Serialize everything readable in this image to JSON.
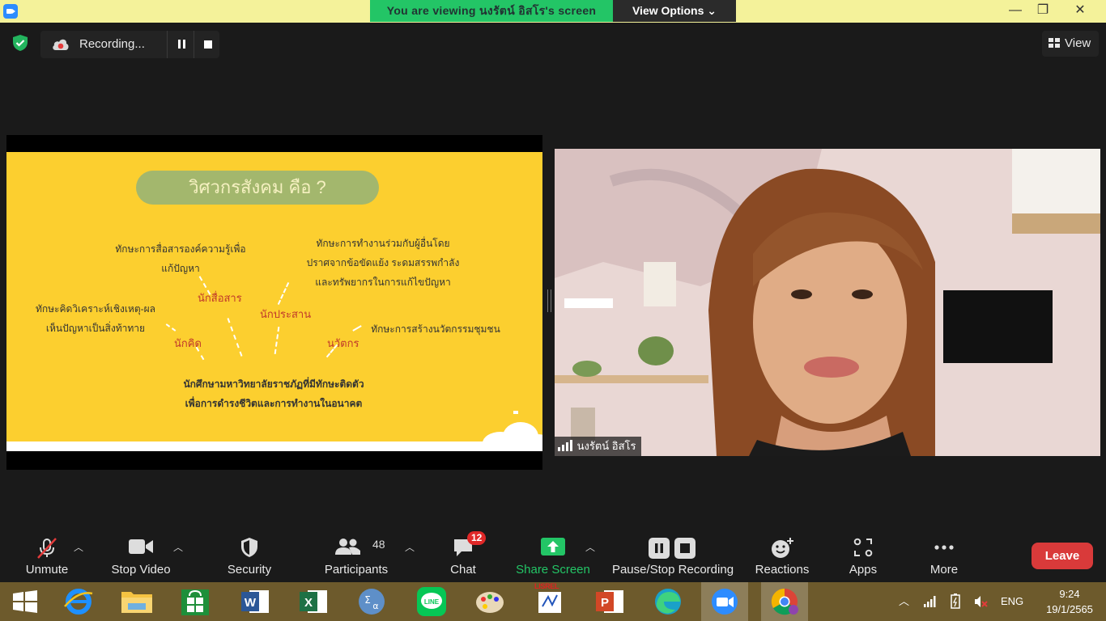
{
  "top_bar": {
    "viewing_banner": "You are viewing นงรัตน์ อิสโร's screen",
    "view_options_label": "View Options",
    "minimize_glyph": "—",
    "restore_glyph": "❐",
    "close_glyph": "✕"
  },
  "meeting_bar": {
    "recording_label": "Recording...",
    "view_label": "View"
  },
  "slide": {
    "title": "วิศวกรสังคม คือ ?",
    "text_communication_1": "ทักษะการสื่อสารองค์ความรู้เพื่อ",
    "text_communication_2": "แก้ปัญหา",
    "label_communicator": "นักสื่อสาร",
    "text_collab_1": "ทักษะการทำงานร่วมกับผู้อื่นโดย",
    "text_collab_2": "ปราศจากข้อขัดแย้ง ระดมสรรพกำลัง",
    "text_collab_3": "และทรัพยากรในการแก้ไขปัญหา",
    "label_coordinator": "นักประสาน",
    "text_thinking_1": "ทักษะคิดวิเคราะห์เชิงเหตุ-ผล",
    "text_thinking_2": "เห็นปัญหาเป็นสิ่งท้าทาย",
    "label_thinker": "นักคิด",
    "text_innovation": "ทักษะการสร้างนวัตกรรมชุมชน",
    "label_innovator": "นวัตกร",
    "text_bottom_1": "นักศึกษามหาวิทยาลัยราชภัฏที่มีทักษะติดตัว",
    "text_bottom_2": "เพื่อการดำรงชีวิตและการทำงานในอนาคต"
  },
  "video": {
    "participant_name": "นงรัตน์ อิสโร"
  },
  "toolbar": {
    "unmute": "Unmute",
    "stop_video": "Stop Video",
    "security": "Security",
    "participants": "Participants",
    "participants_count": "48",
    "chat": "Chat",
    "chat_badge": "12",
    "share_screen": "Share Screen",
    "pause_stop_recording": "Pause/Stop Recording",
    "reactions": "Reactions",
    "apps": "Apps",
    "more": "More",
    "leave": "Leave"
  },
  "taskbar": {
    "lang": "ENG",
    "time": "9:24",
    "date": "19/1/2565",
    "lisrel_label": "LISREL",
    "apps": [
      "start",
      "internet-explorer",
      "file-explorer",
      "store",
      "word",
      "excel",
      "math-input",
      "line",
      "paint",
      "lisrel",
      "powerpoint",
      "edge",
      "zoom",
      "chrome"
    ]
  },
  "colors": {
    "banner_green": "#23c566",
    "top_bar_yellow": "#f4f29a",
    "slide_yellow": "#fccf2f",
    "leave_red": "#d93a3a",
    "share_green": "#23c566"
  }
}
